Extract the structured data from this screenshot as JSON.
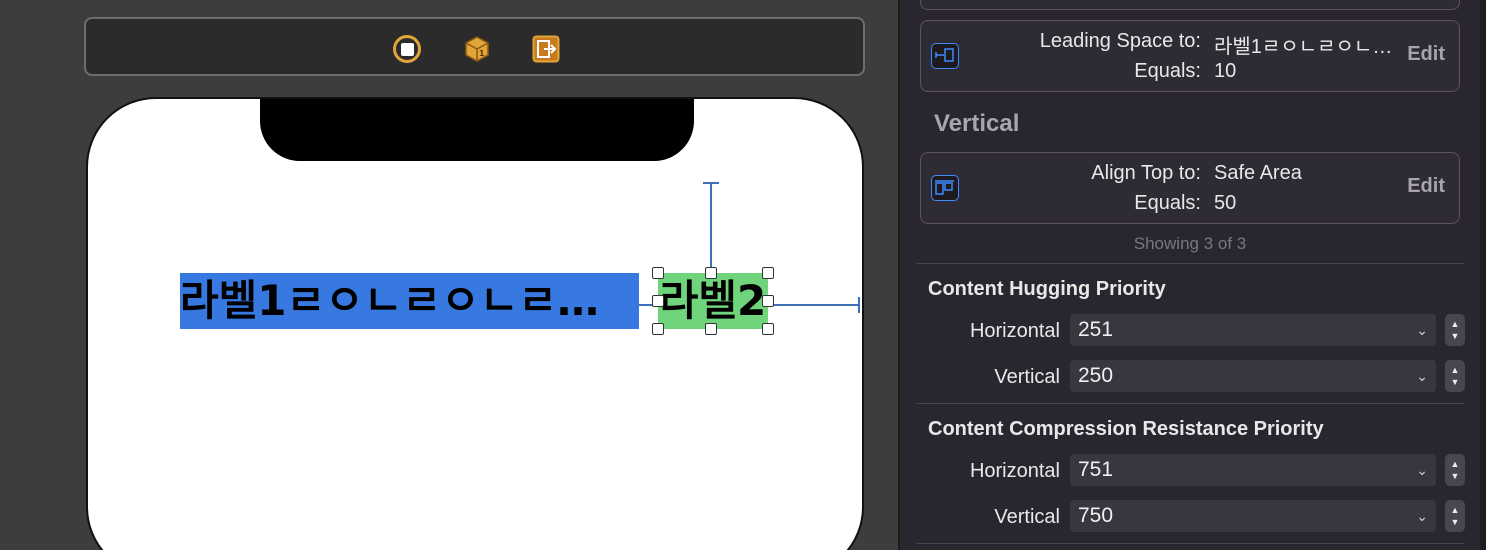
{
  "canvas": {
    "label1_text": "라벨1ㄹㅇㄴㄹㅇㄴㄹ…",
    "label2_text": "라벨2",
    "label1_color": "#3779e0",
    "label2_color": "#6fd47b"
  },
  "inspector": {
    "leading": {
      "k1": "Leading Space to:",
      "v1": "라벨1ㄹㅇㄴㄹㅇㄴ…",
      "k2": "Equals:",
      "v2": "10",
      "edit": "Edit"
    },
    "vertical_title": "Vertical",
    "align": {
      "k1": "Align Top to:",
      "v1": "Safe Area",
      "k2": "Equals:",
      "v2": "50",
      "edit": "Edit"
    },
    "showing": "Showing 3 of 3",
    "hugging": {
      "title": "Content Hugging Priority",
      "h_label": "Horizontal",
      "h_value": "251",
      "v_label": "Vertical",
      "v_value": "250"
    },
    "compression": {
      "title": "Content Compression Resistance Priority",
      "h_label": "Horizontal",
      "h_value": "751",
      "v_label": "Vertical",
      "v_value": "750"
    }
  }
}
